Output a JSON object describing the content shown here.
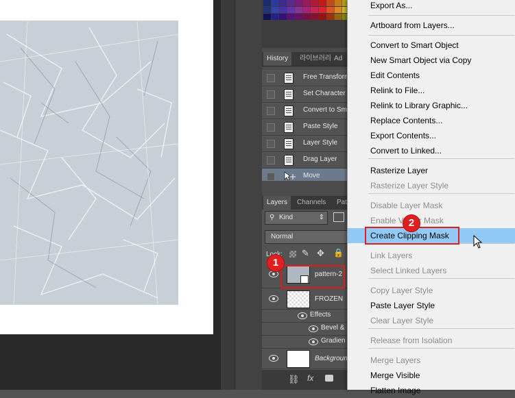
{
  "panels": {
    "history_tabs": [
      "History",
      "라이브러리",
      "Ad"
    ],
    "history_items": [
      {
        "label": "Free Transform",
        "selected": false
      },
      {
        "label": "Set Character",
        "selected": false
      },
      {
        "label": "Convert to Sm",
        "selected": false
      },
      {
        "label": "Paste Style",
        "selected": false
      },
      {
        "label": "Layer Style",
        "selected": false
      },
      {
        "label": "Drag Layer",
        "selected": false
      },
      {
        "label": "Move",
        "selected": true
      }
    ],
    "layers_tabs": [
      "Layers",
      "Channels",
      "Pat"
    ],
    "kind_filter": "Kind",
    "blend_mode": "Normal",
    "lock_label": "Lock:",
    "layers": {
      "pattern": "pattern-2",
      "frozen": "FROZEN",
      "effects": "Effects",
      "bevel": "Bevel &",
      "gradient": "Gradien",
      "background": "Backgroun"
    },
    "footer_fx": "fx"
  },
  "context_menu": {
    "items": [
      {
        "label": "Export As...",
        "disabled": false
      },
      {
        "label": "Artboard from Layers...",
        "disabled": false
      },
      {
        "label": "Convert to Smart Object",
        "disabled": false
      },
      {
        "label": "New Smart Object via Copy",
        "disabled": false
      },
      {
        "label": "Edit Contents",
        "disabled": false
      },
      {
        "label": "Relink to File...",
        "disabled": false
      },
      {
        "label": "Relink to Library Graphic...",
        "disabled": false
      },
      {
        "label": "Replace Contents...",
        "disabled": false
      },
      {
        "label": "Export Contents...",
        "disabled": false
      },
      {
        "label": "Convert to Linked...",
        "disabled": false
      },
      {
        "label": "Rasterize Layer",
        "disabled": false
      },
      {
        "label": "Rasterize Layer Style",
        "disabled": true
      },
      {
        "label": "Disable Layer Mask",
        "disabled": true
      },
      {
        "label": "Enable Vector Mask",
        "disabled": true
      },
      {
        "label": "Create Clipping Mask",
        "disabled": false,
        "highlighted": true
      },
      {
        "label": "Link Layers",
        "disabled": true
      },
      {
        "label": "Select Linked Layers",
        "disabled": true
      },
      {
        "label": "Copy Layer Style",
        "disabled": true
      },
      {
        "label": "Paste Layer Style",
        "disabled": false
      },
      {
        "label": "Clear Layer Style",
        "disabled": true
      },
      {
        "label": "Release from Isolation",
        "disabled": true
      },
      {
        "label": "Merge Layers",
        "disabled": true
      },
      {
        "label": "Merge Visible",
        "disabled": false
      },
      {
        "label": "Flatten Image",
        "disabled": false
      }
    ]
  },
  "annotations": {
    "step1": "1",
    "step2": "2",
    "highlight_color": "#e11a1a"
  }
}
